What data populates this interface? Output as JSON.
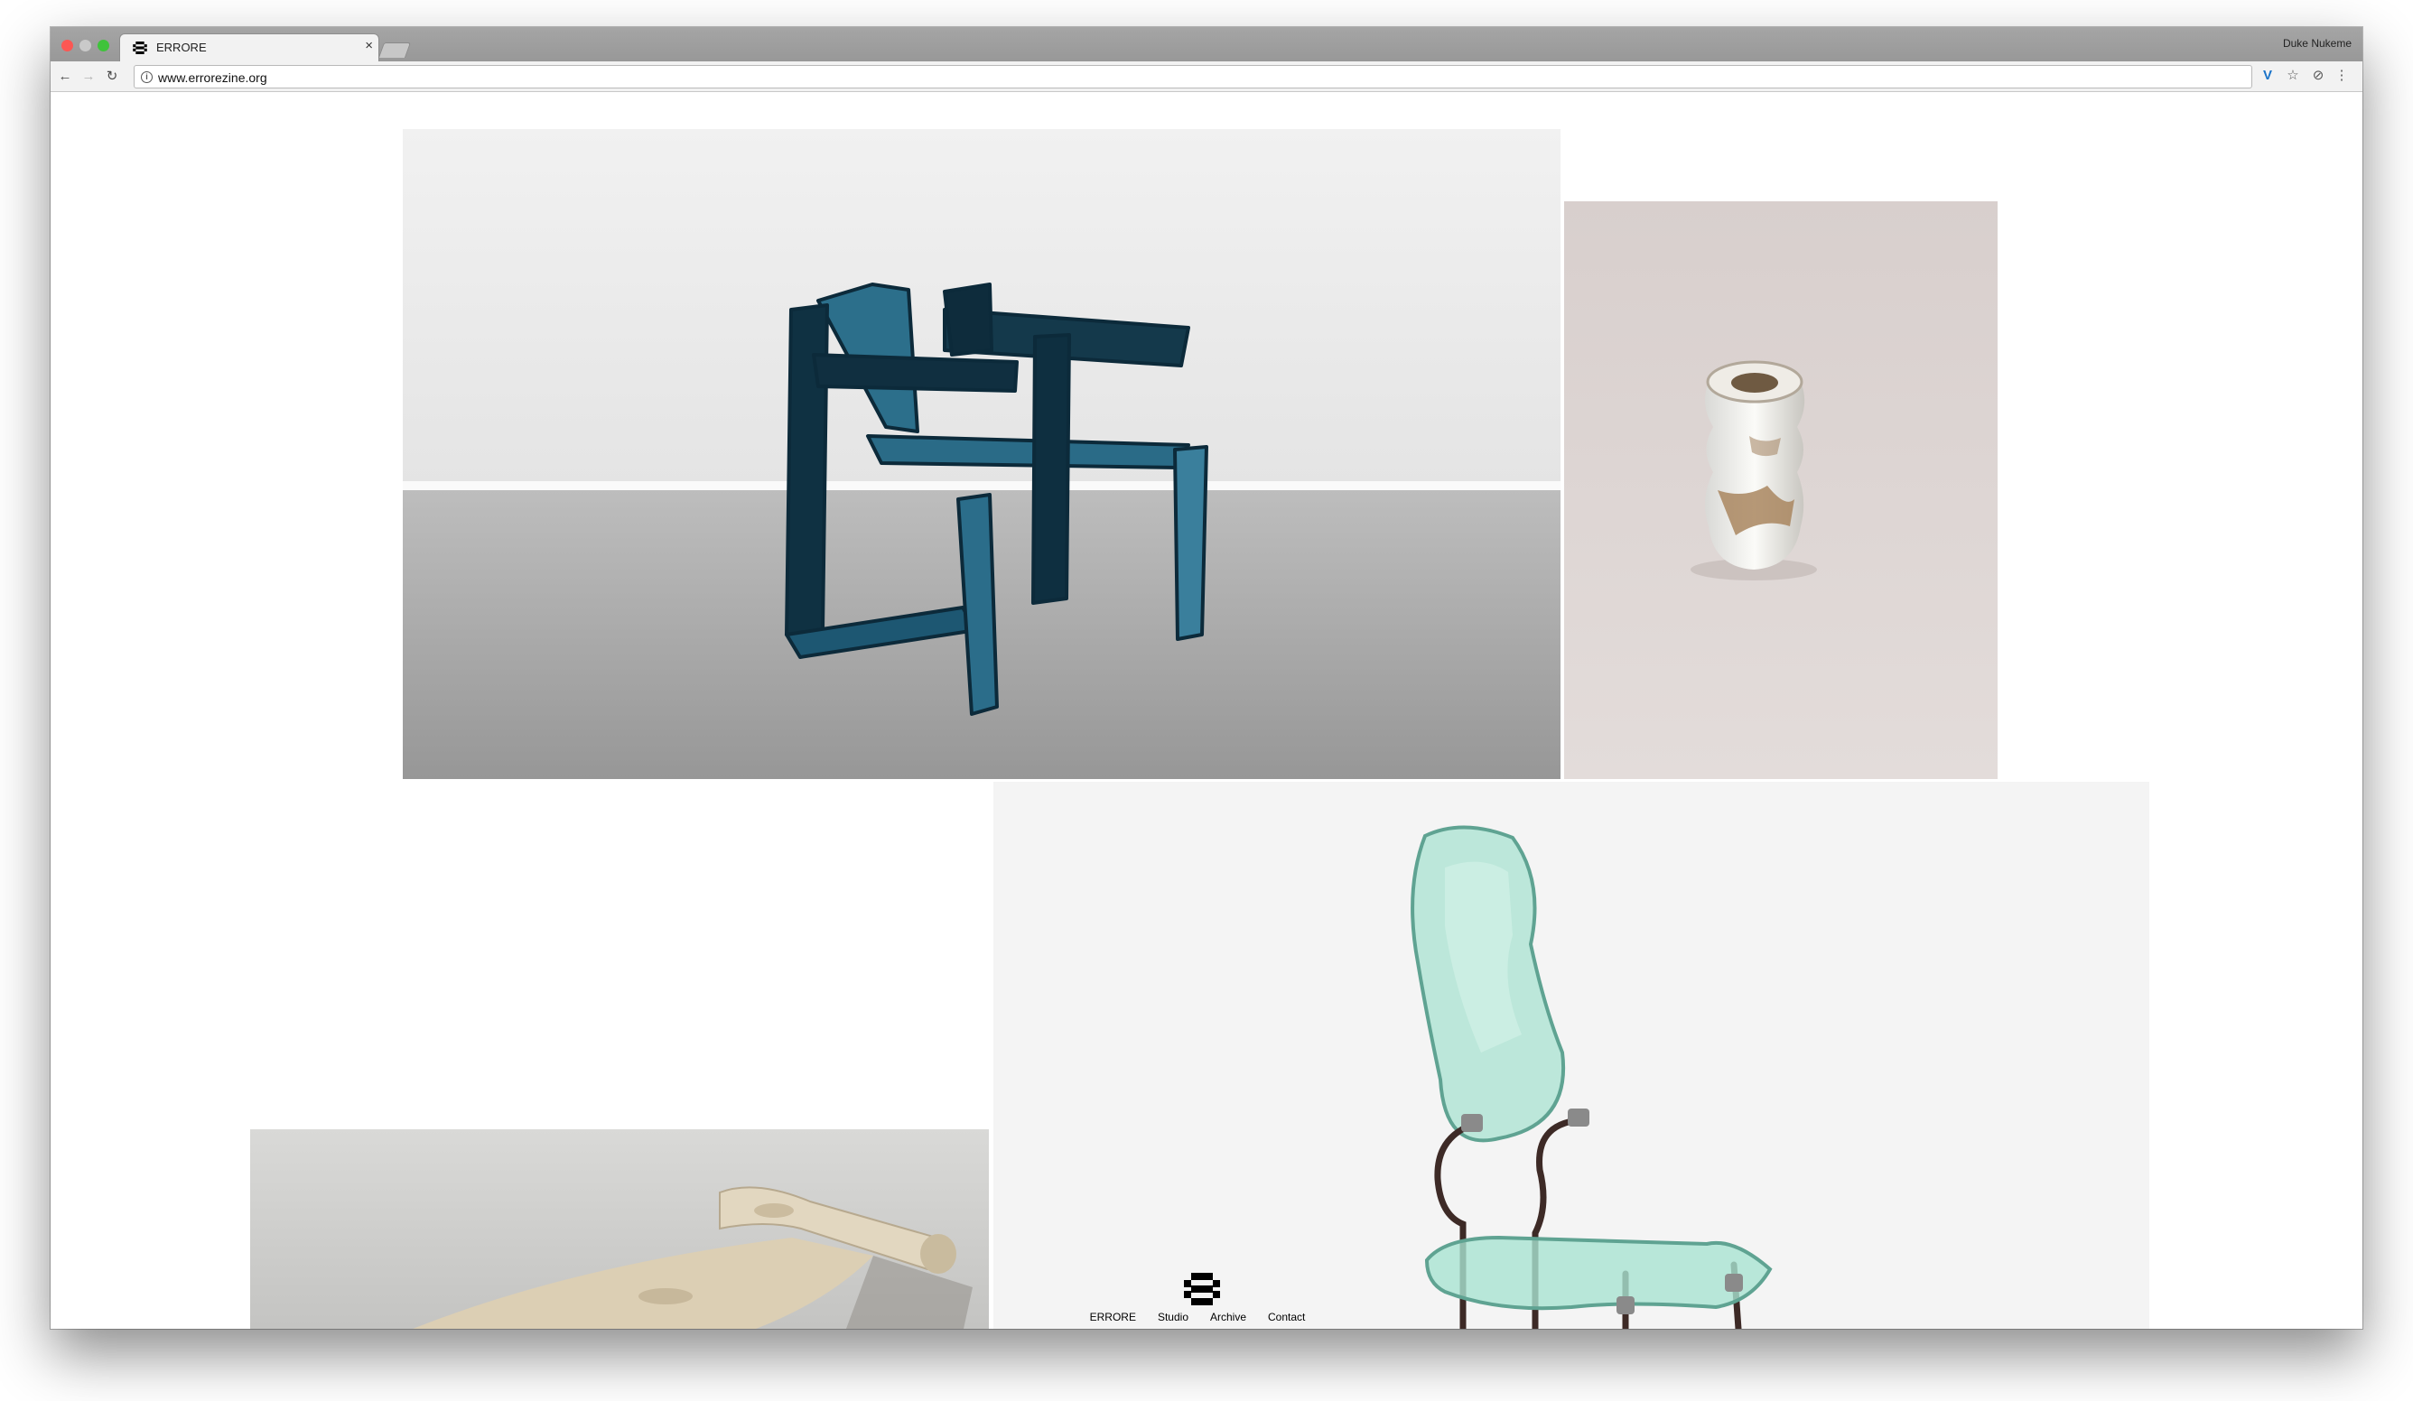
{
  "browser": {
    "tab": {
      "title": "ERRORE",
      "close_glyph": "×",
      "favicon": "errore-logo-icon"
    },
    "profile_name": "Duke Nukeme",
    "nav": {
      "back_glyph": "←",
      "forward_glyph": "→",
      "reload_glyph": "↻"
    },
    "omnibox": {
      "info_glyph": "i",
      "url": "www.errorezine.org"
    },
    "extensions": {
      "vpn_glyph": "V",
      "star_glyph": "☆",
      "block_glyph": "⊘",
      "menu_glyph": "⋮"
    }
  },
  "page": {
    "gallery": [
      {
        "subject": "blue-fabric-chair"
      },
      {
        "subject": "ceramic-vase"
      },
      {
        "subject": "clay-lounger"
      },
      {
        "subject": "glass-chair"
      }
    ],
    "footer": {
      "logo": "errore-logo-icon",
      "links": [
        "ERRORE",
        "Studio",
        "Archive",
        "Contact"
      ]
    }
  },
  "colors": {
    "chair_blue": "#1f5d78",
    "chair_dark": "#0c2a3a",
    "wall": "#ececec",
    "floor": "#a9a9a9",
    "vase_bg": "#ddd6d4",
    "glass": "#a9e3d2",
    "clay": "#d8ccb1",
    "traffic_close": "#fc5753",
    "traffic_max": "#3fc33b"
  }
}
